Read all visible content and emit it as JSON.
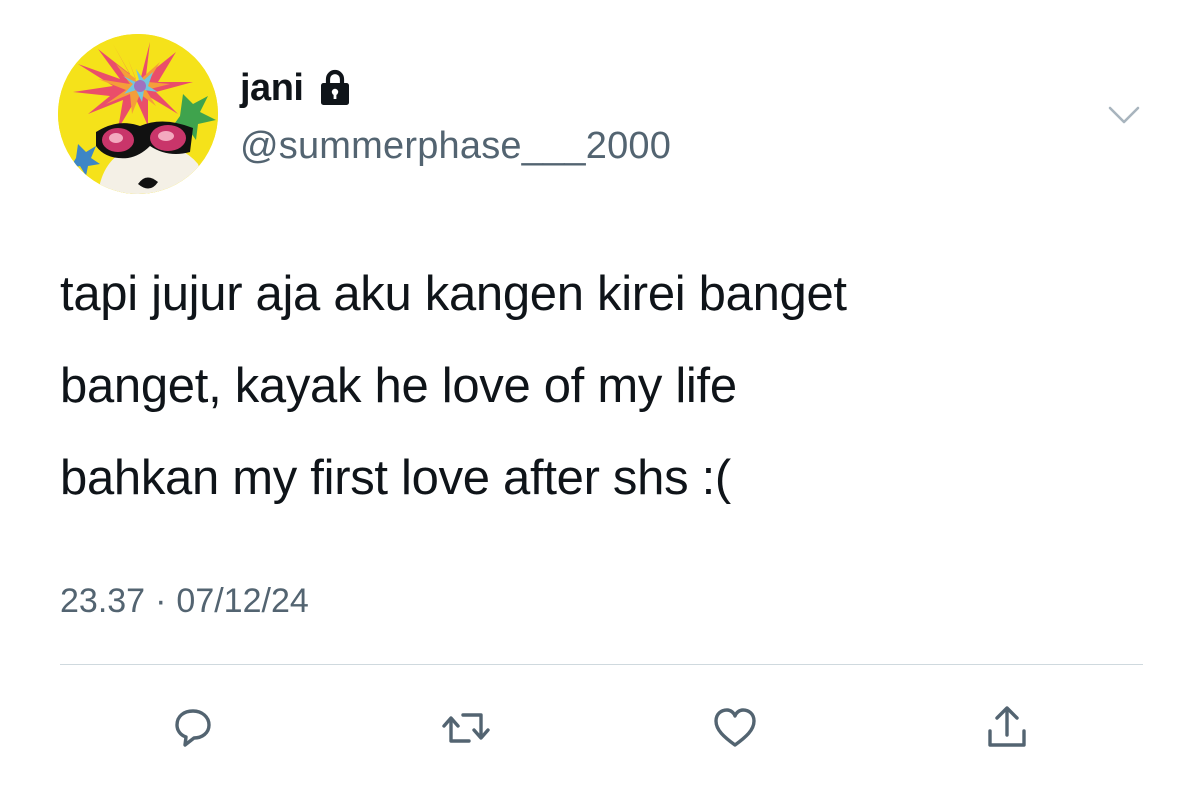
{
  "user": {
    "display_name": "jani",
    "handle": "@summerphase___2000",
    "protected_icon": "lock-icon",
    "avatar_icon": "avatar-image"
  },
  "tweet": {
    "text": "tapi jujur aja aku kangen kirei banget\nbanget, kayak he love of my life\nbahkan my first love after shs :(",
    "time": "23.37",
    "separator": "·",
    "date": "07/12/24"
  },
  "actions": [
    {
      "icon": "reply-icon"
    },
    {
      "icon": "retweet-icon"
    },
    {
      "icon": "like-icon"
    },
    {
      "icon": "share-icon"
    }
  ],
  "menu": {
    "icon": "chevron-down-icon"
  },
  "colors": {
    "text": "#0f1419",
    "secondary": "#536471",
    "divider": "#cfd9de",
    "icon": "#536471"
  }
}
